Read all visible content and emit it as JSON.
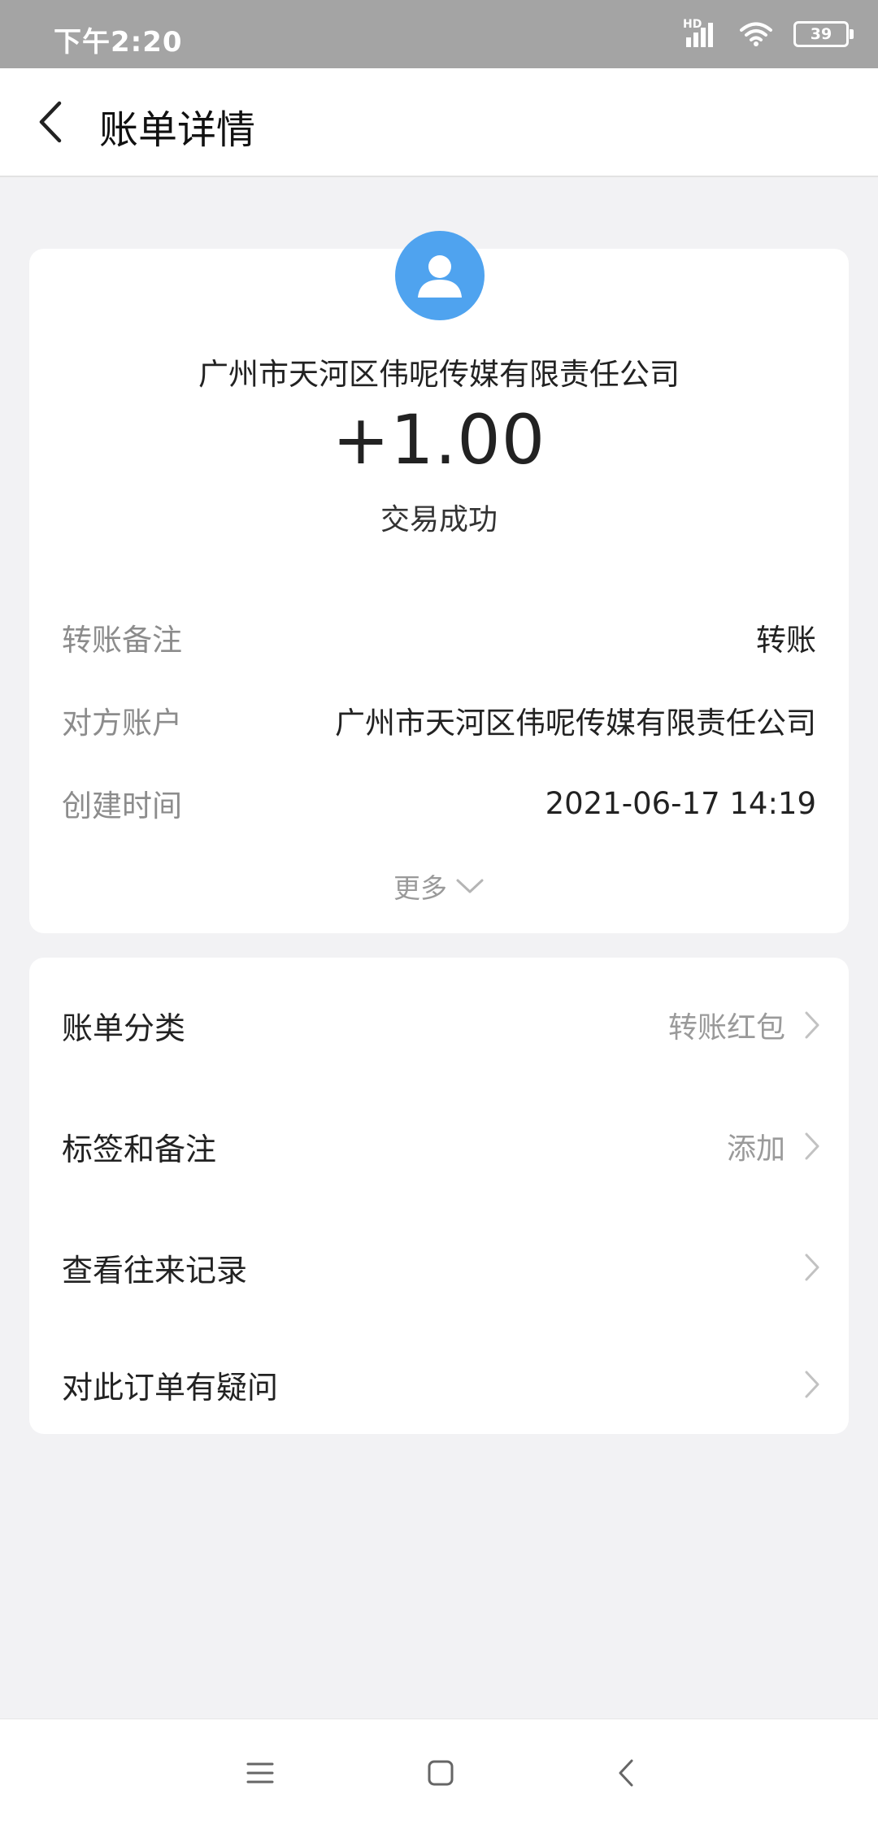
{
  "status_bar": {
    "time": "下午2:20",
    "signal_label": "HD",
    "battery": "39"
  },
  "header": {
    "title": "账单详情"
  },
  "transaction": {
    "party_name": "广州市天河区伟呢传媒有限责任公司",
    "amount": "+1.00",
    "status": "交易成功",
    "avatar_icon": "user-avatar-icon",
    "avatar_color": "#4fa3ef"
  },
  "details": [
    {
      "label": "转账备注",
      "value": "转账"
    },
    {
      "label": "对方账户",
      "value": "广州市天河区伟呢传媒有限责任公司"
    },
    {
      "label": "创建时间",
      "value": "2021-06-17 14:19"
    }
  ],
  "more_label": "更多",
  "menu": [
    {
      "label": "账单分类",
      "value": "转账红包"
    },
    {
      "label": "标签和备注",
      "value": "添加"
    },
    {
      "label": "查看往来记录",
      "value": ""
    },
    {
      "label": "对此订单有疑问",
      "value": ""
    }
  ],
  "nav_bar": {
    "icons": [
      "menu-icon",
      "home-icon",
      "back-icon"
    ]
  }
}
